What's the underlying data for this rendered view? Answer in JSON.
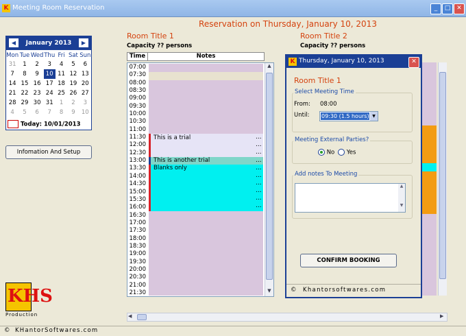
{
  "window": {
    "title": "Meeting Room Reservation"
  },
  "main_title": "Reservation on Thursday, January 10, 2013",
  "calendar": {
    "month_label": "January 2013",
    "prev": "◀",
    "next": "▶",
    "days": [
      "Mon",
      "Tue",
      "Wed",
      "Thu",
      "Fri",
      "Sat",
      "Sun"
    ],
    "weeks": [
      [
        "31",
        "1",
        "2",
        "3",
        "4",
        "5",
        "6"
      ],
      [
        "7",
        "8",
        "9",
        "10",
        "11",
        "12",
        "13"
      ],
      [
        "14",
        "15",
        "16",
        "17",
        "18",
        "19",
        "20"
      ],
      [
        "21",
        "22",
        "23",
        "24",
        "25",
        "26",
        "27"
      ],
      [
        "28",
        "29",
        "30",
        "31",
        "1",
        "2",
        "3"
      ],
      [
        "4",
        "5",
        "6",
        "7",
        "8",
        "9",
        "10"
      ]
    ],
    "today_label": "Today: 10/01/2013"
  },
  "info_button": "Infomation And Setup",
  "room1": {
    "title": "Room Title 1",
    "capacity": "Capacity ?? persons",
    "col_time": "Time",
    "col_notes": "Notes",
    "times": [
      "07:00",
      "07:30",
      "08:00",
      "08:30",
      "09:00",
      "09:30",
      "10:00",
      "10:30",
      "11:00",
      "11:30",
      "12:00",
      "12:30",
      "13:00",
      "13:30",
      "14:00",
      "14:30",
      "15:00",
      "15:30",
      "16:00",
      "16:30",
      "17:00",
      "17:30",
      "18:00",
      "18:30",
      "19:00",
      "19:30",
      "20:00",
      "20:30",
      "21:00",
      "21:30"
    ],
    "booking1_note": "This is a trial",
    "booking2_note": "This is another trial",
    "booking3_note": "Blanks only",
    "ellipsis": "..."
  },
  "room2": {
    "title": "Room Title 2",
    "capacity": "Capacity ?? persons"
  },
  "dialog": {
    "title": "Thursday, January 10, 2013",
    "room": "Room Title 1",
    "group_time": "Select Meeting Time",
    "from_label": "From:",
    "from_value": "08:00",
    "until_label": "Until:",
    "until_value": "09:30 (1.5 hours)",
    "group_external": "Meeting External Parties?",
    "no_label": "No",
    "yes_label": "Yes",
    "group_notes": "Add notes To Meeting",
    "confirm": "CONFIRM BOOKING",
    "footer": "Khantorsoftwares.com"
  },
  "logo": {
    "text": "KHS",
    "sub": "Production"
  },
  "footer": "KHantorSoftwares.com",
  "colors": {
    "accent": "#d4420e",
    "navy": "#1b3f95",
    "slot_free": "#d9c6dd",
    "slot_trial": "#e6e4f6",
    "slot_cyan": "#00f0f0",
    "slot_teal": "#7fd6c9",
    "bar_red": "#d8222a",
    "orange": "#f39c12"
  }
}
